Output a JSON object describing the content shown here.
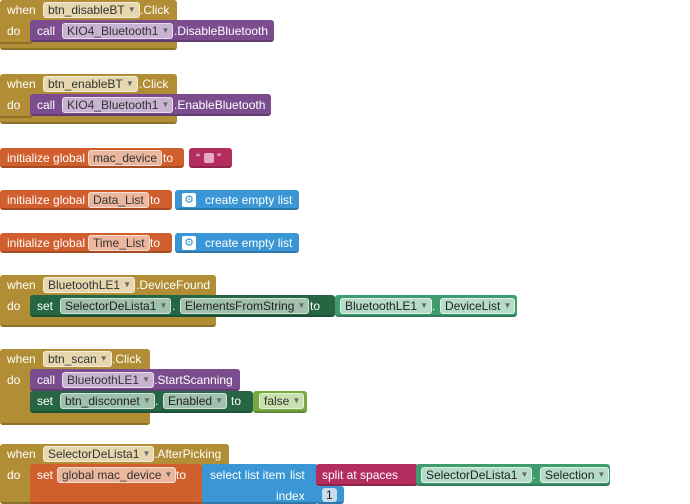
{
  "kw": {
    "when": "when",
    "do": "do",
    "call": "call",
    "set": "set",
    "to": "to",
    "dot": ".",
    "init_global": "initialize global",
    "create_empty_list": "create empty list",
    "select_list_item": "select list item",
    "list": "list",
    "index": "index",
    "split_at_spaces": "split at spaces",
    "quote_open": "“",
    "quote_close": "”"
  },
  "blocks": {
    "b1": {
      "component": "btn_disableBT",
      "event": ".Click",
      "call_component": "KIO4_Bluetooth1",
      "call_method": ".DisableBluetooth"
    },
    "b2": {
      "component": "btn_enableBT",
      "event": ".Click",
      "call_component": "KIO4_Bluetooth1",
      "call_method": ".EnableBluetooth"
    },
    "g1": {
      "name": "mac_device"
    },
    "g2": {
      "name": "Data_List"
    },
    "g3": {
      "name": "Time_List"
    },
    "b3": {
      "component": "BluetoothLE1",
      "event": ".DeviceFound",
      "set_component": "SelectorDeLista1",
      "set_property": "ElementsFromString",
      "value_component": "BluetoothLE1",
      "value_property": "DeviceList"
    },
    "b4": {
      "component": "btn_scan",
      "event": ".Click",
      "call_component": "BluetoothLE1",
      "call_method": ".StartScanning",
      "set_component": "btn_disconnet",
      "set_property": "Enabled",
      "value": "false"
    },
    "b5": {
      "component": "SelectorDeLista1",
      "event": ".AfterPicking",
      "set_var": "global mac_device",
      "split_component": "SelectorDeLista1",
      "split_property": "Selection",
      "index": "1"
    }
  }
}
